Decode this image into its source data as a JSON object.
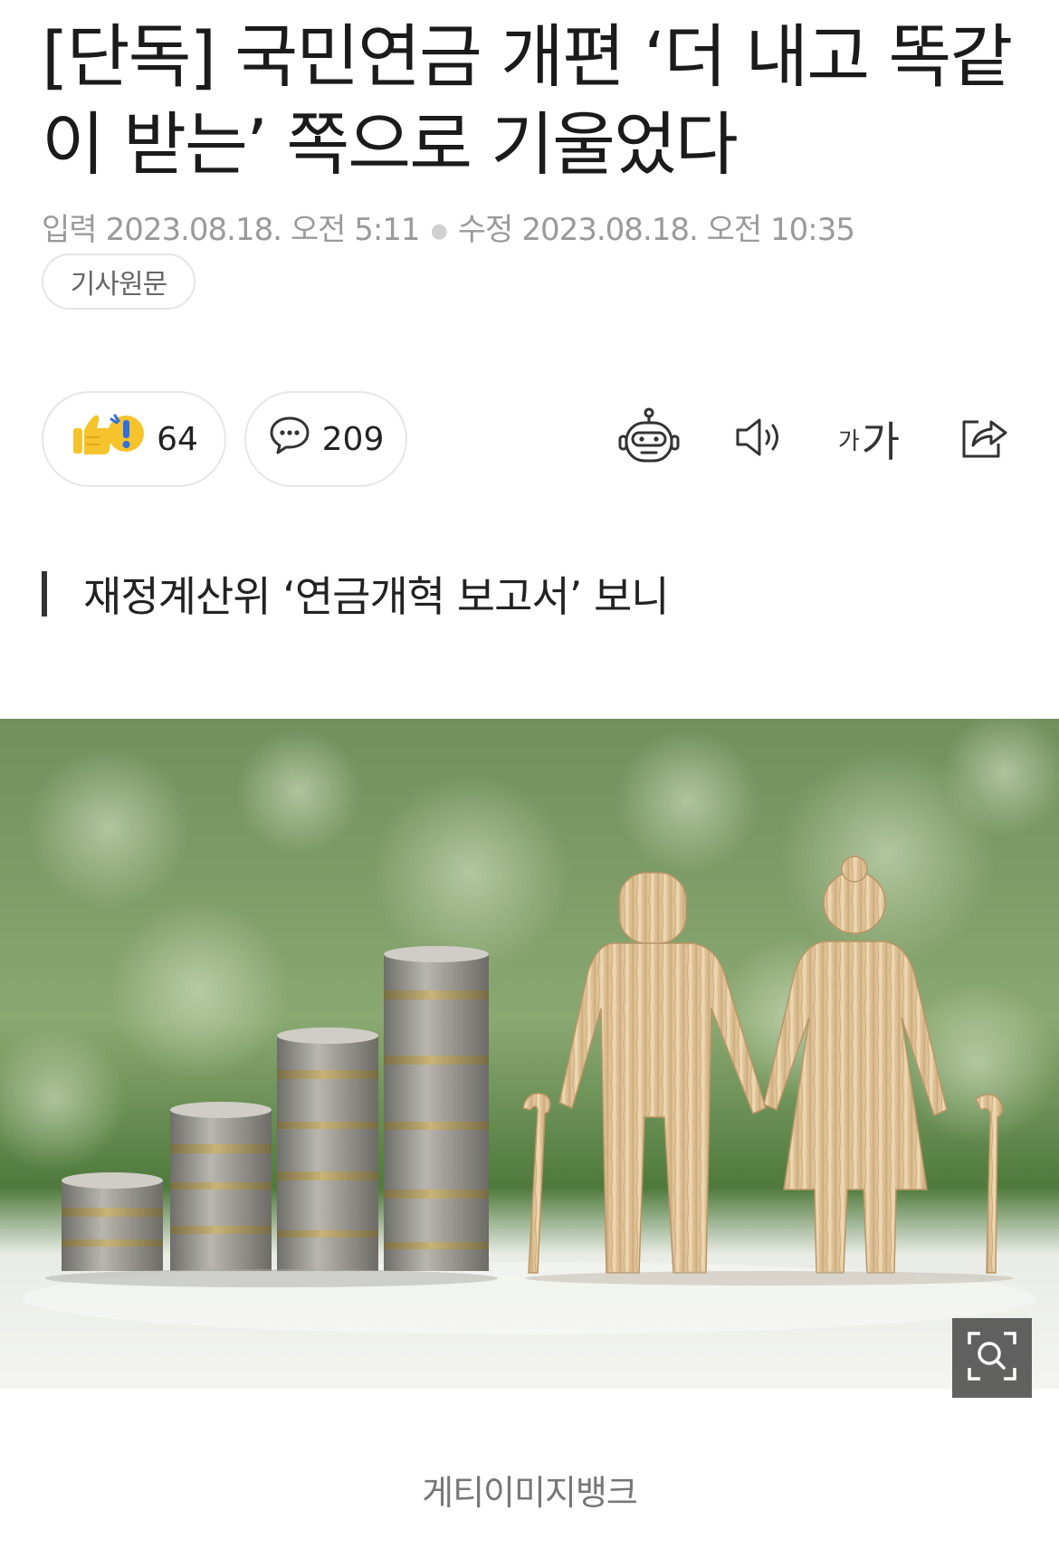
{
  "article": {
    "title": "[단독] 국민연금 개편 ‘더 내고 똑같이 받는’ 쪽으로 기울었다",
    "input_label": "입력",
    "input_time": "2023.08.18. 오전 5:11",
    "modified_label": "수정",
    "modified_time": "2023.08.18. 오전 10:35",
    "original_button": "기사원문",
    "subheading": "재정계산위 ‘연금개혁 보고서’ 보니",
    "photo_caption": "게티이미지뱅크"
  },
  "actions": {
    "reaction_count": "64",
    "comment_count": "209",
    "font_small": "가",
    "font_large": "가"
  },
  "icons": {
    "reaction": "thumbs-up-exclaim-icon",
    "comment": "speech-bubble-icon",
    "summary": "robot-icon",
    "tts": "speaker-icon",
    "font_size": "font-size-icon",
    "share": "share-icon",
    "zoom": "zoom-icon"
  },
  "colors": {
    "emoji_yellow": "#f5c32c",
    "emoji_blue": "#2f6fe0",
    "caption_gray": "#777777"
  }
}
